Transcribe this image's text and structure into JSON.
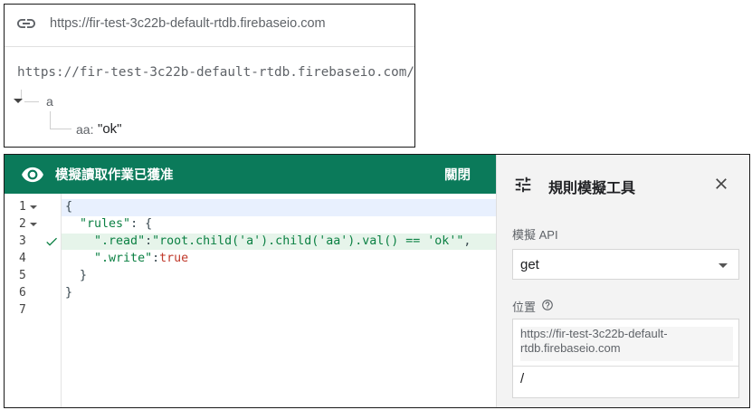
{
  "database": {
    "url_bar_text": "https://fir-test-3c22b-default-rtdb.firebaseio.com",
    "root_path": "https://fir-test-3c22b-default-rtdb.firebaseio.com/",
    "node_a": "a",
    "child_key": "aa:",
    "child_value": "\"ok\""
  },
  "simulation_banner": {
    "message": "模擬讀取作業已獲准",
    "close_label": "關閉",
    "color": "#0b7a5a"
  },
  "editor": {
    "line_numbers": [
      "1",
      "2",
      "3",
      "4",
      "5",
      "6",
      "7"
    ],
    "lines": {
      "l1": "{",
      "l2_key": "\"rules\"",
      "l2_rest": ": {",
      "l3_key": "\".read\"",
      "l3_colon": ":",
      "l3_value": "\"root.child('a').child('aa').val() == 'ok'\"",
      "l3_comma": ",",
      "l4_key": "\".write\"",
      "l4_colon": ":",
      "l4_value": "true",
      "l5": "}",
      "l6": "}"
    },
    "passing_line": "3"
  },
  "rules_simulator": {
    "title": "規則模擬工具",
    "api_label": "模擬 API",
    "api_value": "get",
    "location_label": "位置",
    "location_prefix": "https://fir-test-3c22b-default-rtdb.firebaseio.com",
    "location_path": "/"
  },
  "icons": {
    "url": "link-icon",
    "banner": "eye-icon",
    "panel": "tune-icon",
    "close": "close-icon",
    "help": "help-icon",
    "pass": "check-icon"
  }
}
